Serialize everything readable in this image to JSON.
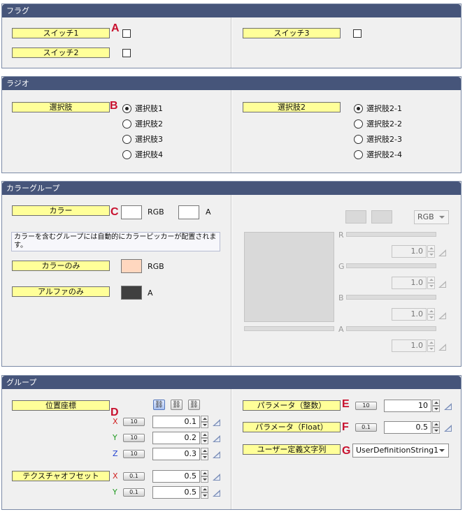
{
  "panels": {
    "flags": {
      "title": "フラグ",
      "items": [
        {
          "label": "スイッチ1",
          "checked": false
        },
        {
          "label": "スイッチ2",
          "checked": false
        },
        {
          "label": "スイッチ3",
          "checked": false
        }
      ]
    },
    "radio": {
      "title": "ラジオ",
      "group1": {
        "label": "選択肢",
        "options": [
          "選択肢1",
          "選択肢2",
          "選択肢3",
          "選択肢4"
        ],
        "selected": 0
      },
      "group2": {
        "label": "選択肢2",
        "options": [
          "選択肢2-1",
          "選択肢2-2",
          "選択肢2-3",
          "選択肢2-4"
        ],
        "selected": 0
      }
    },
    "color": {
      "title": "カラーグループ",
      "color_label": "カラー",
      "rgb_suffix": "RGB",
      "alpha_suffix": "A",
      "info_text": "カラーを含むグループには自動的にカラーピッカーが配置されます。",
      "color_only_label": "カラーのみ",
      "color_only_suffix": "RGB",
      "color_only_value": "#ffd7bf",
      "alpha_only_label": "アルファのみ",
      "alpha_only_suffix": "A",
      "alpha_only_value": "#404040",
      "picker": {
        "mode": "RGB",
        "channels": [
          {
            "name": "R",
            "value": "1.0"
          },
          {
            "name": "G",
            "value": "1.0"
          },
          {
            "name": "B",
            "value": "1.0"
          },
          {
            "name": "A",
            "value": "1.0"
          }
        ]
      }
    },
    "group": {
      "title": "グループ",
      "position": {
        "label": "位置座標",
        "rows": [
          {
            "axis": "X",
            "scale": "10",
            "value": "0.1"
          },
          {
            "axis": "Y",
            "scale": "10",
            "value": "0.2"
          },
          {
            "axis": "Z",
            "scale": "10",
            "value": "0.3"
          }
        ]
      },
      "texture_offset": {
        "label": "テクスチャオフセット",
        "rows": [
          {
            "axis": "X",
            "scale": "0.1",
            "value": "0.5"
          },
          {
            "axis": "Y",
            "scale": "0.1",
            "value": "0.5"
          }
        ]
      },
      "param_int": {
        "label": "パラメータ（整数）",
        "scale": "10",
        "value": "10"
      },
      "param_float": {
        "label": "パラメータ（Float）",
        "scale": "0.1",
        "value": "0.5"
      },
      "user_string": {
        "label": "ユーザー定義文字列",
        "value": "UserDefinitionString1"
      }
    }
  },
  "markers": [
    "A",
    "B",
    "C",
    "D",
    "E",
    "F",
    "G"
  ],
  "colors": {
    "header_bg": "#46557a",
    "label_bg": "#ffff99",
    "marker": "#c8102e",
    "axis_x": "#d02020",
    "axis_y": "#1f9a1f",
    "axis_z": "#2040d0"
  }
}
